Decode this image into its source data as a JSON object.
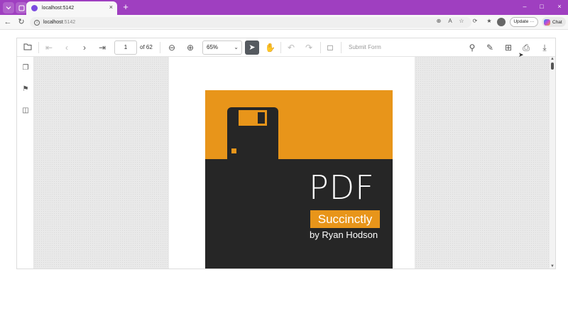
{
  "browser": {
    "tab_title": "localhost:5142",
    "address_host": "localhost",
    "address_port": ":5142",
    "update_label": "Update",
    "update_more": "···",
    "chat_label": "Chat",
    "new_tab_glyph": "+",
    "close_glyph": "×",
    "minimize_glyph": "–",
    "maximize_glyph": "□",
    "window_close_glyph": "×"
  },
  "toolbar": {
    "current_page": "1",
    "page_count_label": "of 62",
    "zoom_value": "65%",
    "submit_form_label": "Submit Form",
    "icons": [
      "open-file-icon",
      "first-page-icon",
      "previous-page-icon",
      "next-page-icon",
      "last-page-icon",
      "zoom-out-icon",
      "zoom-in-icon",
      "select-tool-icon",
      "pan-tool-icon",
      "undo-icon",
      "redo-icon",
      "comment-icon",
      "search-icon",
      "annotation-icon",
      "form-designer-icon",
      "print-icon",
      "download-icon"
    ]
  },
  "sidebar": {
    "icons": [
      "page-thumbnails-icon",
      "bookmarks-icon",
      "organize-pages-icon"
    ]
  },
  "document": {
    "cover_title": "PDF",
    "cover_series": "Succinctly",
    "cover_author": "by Ryan Hodson"
  },
  "colors": {
    "tab_strip": "#9f3fc0",
    "cover_accent": "#e8951a",
    "cover_dark": "#262626",
    "active_tool": "#555a60"
  }
}
